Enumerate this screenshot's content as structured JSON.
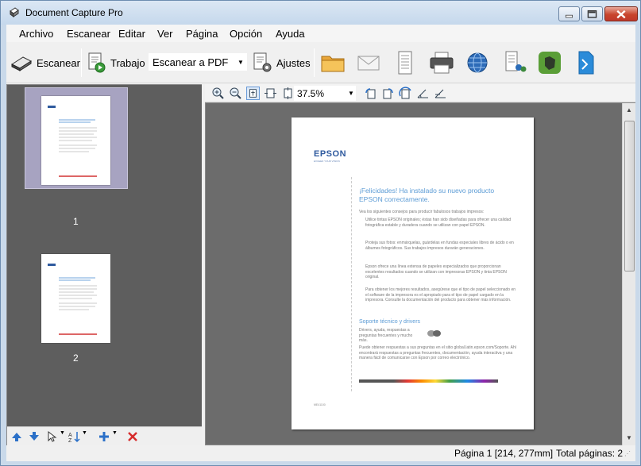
{
  "window": {
    "title": "Document Capture Pro"
  },
  "menu": [
    "Archivo",
    "Escanear",
    "Editar",
    "Ver",
    "Página",
    "Opción",
    "Ayuda"
  ],
  "toolbar": {
    "scan_label": "Escanear",
    "job_label": "Trabajo",
    "job_value": "Escanear a PDF",
    "settings_label": "Ajustes"
  },
  "thumbnails": [
    {
      "number": "1"
    },
    {
      "number": "2"
    }
  ],
  "viewer": {
    "zoom": "37.5%"
  },
  "document": {
    "logo": "EPSON",
    "tagline": "EXCEED YOUR VISION",
    "heading": "¡Felicidades! Ha instalado su nuevo producto EPSON correctamente.",
    "intro": "Vea los siguientes consejos para producir fabulosos trabajos impresos:",
    "bullets": [
      "Utilice tintas EPSON originales; éstas han sido diseñadas para ofrecer una calidad fotográfica estable y duradera cuando se utilizan con papel EPSON.",
      "Proteja sus fotos: enmárquelas, guárdelas en fundas especiales libres de ácido o en álbumes fotográficos. Sus trabajos impresos durarán generaciones.",
      "Epson ofrece una línea extensa de papeles especializados que proporcionan excelentes resultados cuando se utilizan con impresoras EPSON y tinta EPSON original.",
      "Para obtener los mejores resultados, asegúrese que el tipo de papel seleccionado en el software de la impresora es el apropiado para el tipo de papel cargado en la impresora. Consulte la documentación del producto para obtener más información."
    ],
    "support_heading": "Soporte técnico y drivers",
    "support_text": "Drivers, ayuda, respuestas a preguntas frecuentes y mucho más.",
    "support_detail": "Puede obtener respuestas a sus preguntas en el sitio global.latin.epson.com/Soporte. Ahí encontrará respuestas a preguntas frecuentes, documentación, ayuda interactiva y una manera fácil de comunicarse con Epson por correo electrónico.",
    "code": "ME41100"
  },
  "status": {
    "page_info": "Página 1 [214, 277mm]",
    "total_pages": "Total páginas: 2"
  },
  "colors": {
    "accent": "#5b9bd5",
    "epson_blue": "#2f5a9e",
    "viewer_bg": "#6c6c6c"
  }
}
